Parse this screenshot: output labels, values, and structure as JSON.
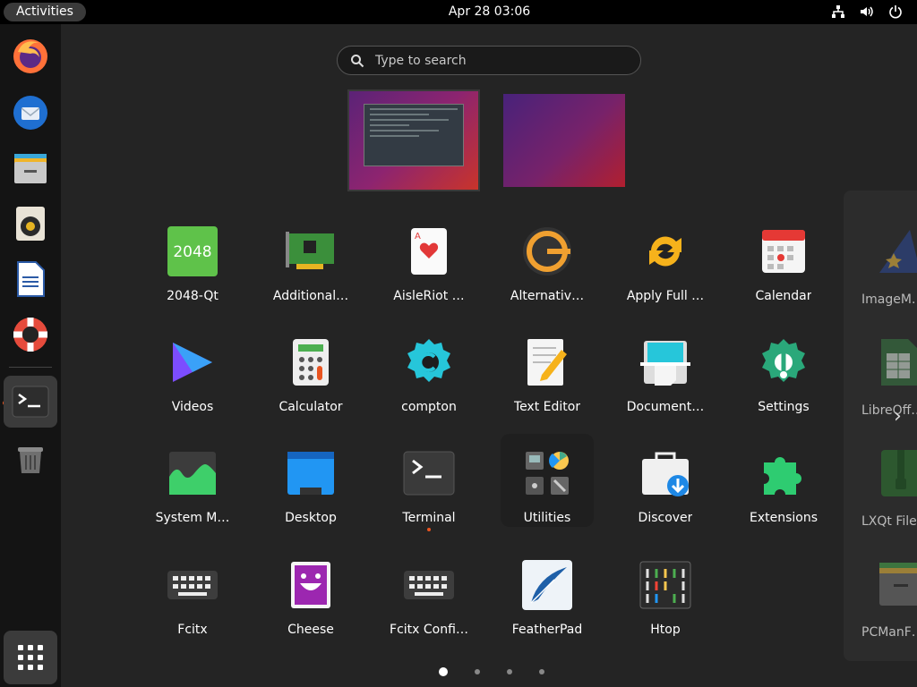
{
  "topbar": {
    "activities": "Activities",
    "clock": "Apr 28  03:06",
    "tray_icons": [
      "network-icon",
      "volume-icon",
      "power-icon"
    ]
  },
  "dock": {
    "items": [
      {
        "name": "Firefox",
        "icon": "firefox-icon"
      },
      {
        "name": "Thunderbird",
        "icon": "thunderbird-icon"
      },
      {
        "name": "Files",
        "icon": "files-icon"
      },
      {
        "name": "Rhythmbox",
        "icon": "rhythmbox-icon"
      },
      {
        "name": "LibreOffice Writer",
        "icon": "writer-icon"
      },
      {
        "name": "Help",
        "icon": "help-icon"
      },
      {
        "name": "Terminal",
        "icon": "terminal-icon",
        "running": true
      },
      {
        "name": "Trash",
        "icon": "trash-icon"
      }
    ],
    "show_apps_icon": "grid-icon"
  },
  "search": {
    "placeholder": "Type to search"
  },
  "workspaces": [
    "workspace-1",
    "workspace-2"
  ],
  "apps": [
    {
      "label": "2048-Qt",
      "icon": "game-2048-icon"
    },
    {
      "label": "Additional…",
      "icon": "hardware-card-icon"
    },
    {
      "label": "AisleRiot …",
      "icon": "cards-icon"
    },
    {
      "label": "Alternativ…",
      "icon": "alternatives-icon"
    },
    {
      "label": "Apply Full …",
      "icon": "upgrade-icon"
    },
    {
      "label": "Calendar",
      "icon": "calendar-icon"
    },
    {
      "label": "Videos",
      "icon": "videos-icon"
    },
    {
      "label": "Calculator",
      "icon": "calculator-icon"
    },
    {
      "label": "compton",
      "icon": "compton-gear-icon"
    },
    {
      "label": "Text Editor",
      "icon": "text-editor-icon"
    },
    {
      "label": "Document…",
      "icon": "document-scanner-icon"
    },
    {
      "label": "Settings",
      "icon": "settings-icon"
    },
    {
      "label": "System M…",
      "icon": "system-monitor-icon"
    },
    {
      "label": "Desktop",
      "icon": "desktop-icon"
    },
    {
      "label": "Terminal",
      "icon": "terminal-icon",
      "running": true
    },
    {
      "label": "Utilities",
      "icon": "utilities-folder-icon"
    },
    {
      "label": "Discover",
      "icon": "discover-icon"
    },
    {
      "label": "Extensions",
      "icon": "puzzle-icon"
    },
    {
      "label": "Fcitx",
      "icon": "keyboard-icon"
    },
    {
      "label": "Cheese",
      "icon": "cheese-icon"
    },
    {
      "label": "Fcitx Confi…",
      "icon": "keyboard-icon"
    },
    {
      "label": "FeatherPad",
      "icon": "feather-icon"
    },
    {
      "label": "Htop",
      "icon": "htop-icon"
    }
  ],
  "next_page_peek": [
    {
      "label": "ImageM…",
      "icon": "wizard-hat-icon"
    },
    {
      "label": "LibreOff…",
      "icon": "spreadsheet-icon"
    },
    {
      "label": "LXQt File…",
      "icon": "archive-icon"
    },
    {
      "label": "PCManF…",
      "icon": "folder-icon"
    }
  ],
  "pagination": {
    "pages": 4,
    "current": 1
  },
  "colors": {
    "accent": "#e95420",
    "panel": "#000000",
    "dock": "#141414",
    "background": "#242424"
  }
}
